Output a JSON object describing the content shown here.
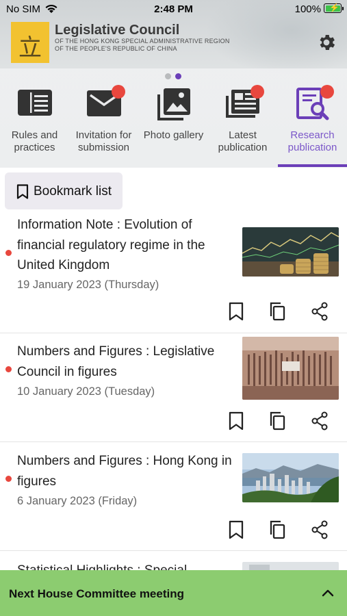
{
  "status_bar": {
    "carrier": "No SIM",
    "time": "2:48 PM",
    "battery_percent": "100%"
  },
  "header": {
    "logo_glyph": "立",
    "title": "Legislative Council",
    "subtitle_line1": "OF THE HONG KONG SPECIAL ADMINISTRATIVE REGION",
    "subtitle_line2": "OF THE PEOPLE'S REPUBLIC OF CHINA",
    "settings_icon": "gear-icon"
  },
  "carousel": {
    "pages": 2,
    "current_page": 2
  },
  "categories": [
    {
      "label": "Rules and practices",
      "icon": "book-icon",
      "badge": false,
      "active": false
    },
    {
      "label": "Invitation for submission",
      "icon": "envelope-icon",
      "badge": true,
      "active": false
    },
    {
      "label": "Photo gallery",
      "icon": "photo-gallery-icon",
      "badge": false,
      "active": false
    },
    {
      "label": "Latest publication",
      "icon": "newspaper-icon",
      "badge": true,
      "active": false
    },
    {
      "label": "Research publication",
      "icon": "research-document-icon",
      "badge": true,
      "active": true
    }
  ],
  "bookmark_chip": {
    "label": "Bookmark list"
  },
  "items": [
    {
      "title": "Information Note : Evolution of financial regulatory regime in the United Kingdom",
      "date": "19 January 2023 (Thursday)",
      "unread": true
    },
    {
      "title": "Numbers and Figures : Legislative Council in figures",
      "date": "10 January 2023 (Tuesday)",
      "unread": true
    },
    {
      "title": "Numbers and Figures : Hong Kong in figures",
      "date": "6 January 2023 (Friday)",
      "unread": true
    },
    {
      "title": "Statistical Highlights : Special",
      "date": "",
      "unread": false
    }
  ],
  "bottom_bar": {
    "label": "Next House Committee meeting"
  },
  "colors": {
    "accent": "#6b3fb8",
    "badge": "#e8473e",
    "bottom_bar": "#8ccc70",
    "logo": "#f2c230"
  }
}
